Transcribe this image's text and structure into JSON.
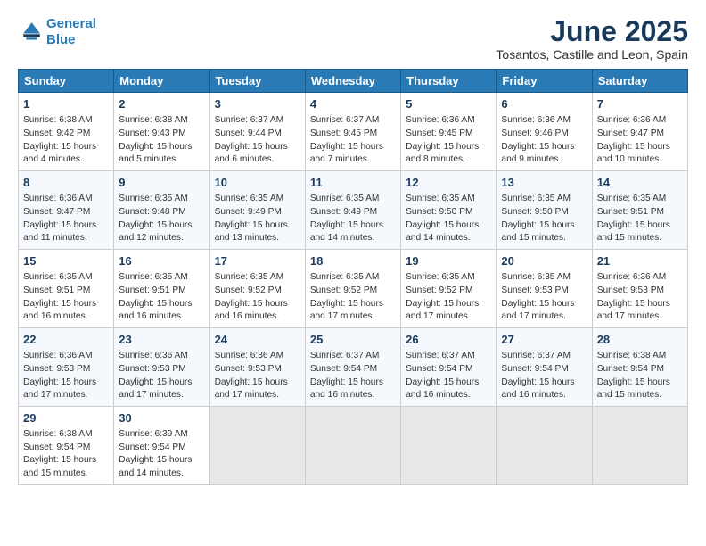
{
  "logo": {
    "line1": "General",
    "line2": "Blue"
  },
  "title": "June 2025",
  "subtitle": "Tosantos, Castille and Leon, Spain",
  "headers": [
    "Sunday",
    "Monday",
    "Tuesday",
    "Wednesday",
    "Thursday",
    "Friday",
    "Saturday"
  ],
  "weeks": [
    [
      {
        "day": "1",
        "lines": [
          "Sunrise: 6:38 AM",
          "Sunset: 9:42 PM",
          "Daylight: 15 hours",
          "and 4 minutes."
        ]
      },
      {
        "day": "2",
        "lines": [
          "Sunrise: 6:38 AM",
          "Sunset: 9:43 PM",
          "Daylight: 15 hours",
          "and 5 minutes."
        ]
      },
      {
        "day": "3",
        "lines": [
          "Sunrise: 6:37 AM",
          "Sunset: 9:44 PM",
          "Daylight: 15 hours",
          "and 6 minutes."
        ]
      },
      {
        "day": "4",
        "lines": [
          "Sunrise: 6:37 AM",
          "Sunset: 9:45 PM",
          "Daylight: 15 hours",
          "and 7 minutes."
        ]
      },
      {
        "day": "5",
        "lines": [
          "Sunrise: 6:36 AM",
          "Sunset: 9:45 PM",
          "Daylight: 15 hours",
          "and 8 minutes."
        ]
      },
      {
        "day": "6",
        "lines": [
          "Sunrise: 6:36 AM",
          "Sunset: 9:46 PM",
          "Daylight: 15 hours",
          "and 9 minutes."
        ]
      },
      {
        "day": "7",
        "lines": [
          "Sunrise: 6:36 AM",
          "Sunset: 9:47 PM",
          "Daylight: 15 hours",
          "and 10 minutes."
        ]
      }
    ],
    [
      {
        "day": "8",
        "lines": [
          "Sunrise: 6:36 AM",
          "Sunset: 9:47 PM",
          "Daylight: 15 hours",
          "and 11 minutes."
        ]
      },
      {
        "day": "9",
        "lines": [
          "Sunrise: 6:35 AM",
          "Sunset: 9:48 PM",
          "Daylight: 15 hours",
          "and 12 minutes."
        ]
      },
      {
        "day": "10",
        "lines": [
          "Sunrise: 6:35 AM",
          "Sunset: 9:49 PM",
          "Daylight: 15 hours",
          "and 13 minutes."
        ]
      },
      {
        "day": "11",
        "lines": [
          "Sunrise: 6:35 AM",
          "Sunset: 9:49 PM",
          "Daylight: 15 hours",
          "and 14 minutes."
        ]
      },
      {
        "day": "12",
        "lines": [
          "Sunrise: 6:35 AM",
          "Sunset: 9:50 PM",
          "Daylight: 15 hours",
          "and 14 minutes."
        ]
      },
      {
        "day": "13",
        "lines": [
          "Sunrise: 6:35 AM",
          "Sunset: 9:50 PM",
          "Daylight: 15 hours",
          "and 15 minutes."
        ]
      },
      {
        "day": "14",
        "lines": [
          "Sunrise: 6:35 AM",
          "Sunset: 9:51 PM",
          "Daylight: 15 hours",
          "and 15 minutes."
        ]
      }
    ],
    [
      {
        "day": "15",
        "lines": [
          "Sunrise: 6:35 AM",
          "Sunset: 9:51 PM",
          "Daylight: 15 hours",
          "and 16 minutes."
        ]
      },
      {
        "day": "16",
        "lines": [
          "Sunrise: 6:35 AM",
          "Sunset: 9:51 PM",
          "Daylight: 15 hours",
          "and 16 minutes."
        ]
      },
      {
        "day": "17",
        "lines": [
          "Sunrise: 6:35 AM",
          "Sunset: 9:52 PM",
          "Daylight: 15 hours",
          "and 16 minutes."
        ]
      },
      {
        "day": "18",
        "lines": [
          "Sunrise: 6:35 AM",
          "Sunset: 9:52 PM",
          "Daylight: 15 hours",
          "and 17 minutes."
        ]
      },
      {
        "day": "19",
        "lines": [
          "Sunrise: 6:35 AM",
          "Sunset: 9:52 PM",
          "Daylight: 15 hours",
          "and 17 minutes."
        ]
      },
      {
        "day": "20",
        "lines": [
          "Sunrise: 6:35 AM",
          "Sunset: 9:53 PM",
          "Daylight: 15 hours",
          "and 17 minutes."
        ]
      },
      {
        "day": "21",
        "lines": [
          "Sunrise: 6:36 AM",
          "Sunset: 9:53 PM",
          "Daylight: 15 hours",
          "and 17 minutes."
        ]
      }
    ],
    [
      {
        "day": "22",
        "lines": [
          "Sunrise: 6:36 AM",
          "Sunset: 9:53 PM",
          "Daylight: 15 hours",
          "and 17 minutes."
        ]
      },
      {
        "day": "23",
        "lines": [
          "Sunrise: 6:36 AM",
          "Sunset: 9:53 PM",
          "Daylight: 15 hours",
          "and 17 minutes."
        ]
      },
      {
        "day": "24",
        "lines": [
          "Sunrise: 6:36 AM",
          "Sunset: 9:53 PM",
          "Daylight: 15 hours",
          "and 17 minutes."
        ]
      },
      {
        "day": "25",
        "lines": [
          "Sunrise: 6:37 AM",
          "Sunset: 9:54 PM",
          "Daylight: 15 hours",
          "and 16 minutes."
        ]
      },
      {
        "day": "26",
        "lines": [
          "Sunrise: 6:37 AM",
          "Sunset: 9:54 PM",
          "Daylight: 15 hours",
          "and 16 minutes."
        ]
      },
      {
        "day": "27",
        "lines": [
          "Sunrise: 6:37 AM",
          "Sunset: 9:54 PM",
          "Daylight: 15 hours",
          "and 16 minutes."
        ]
      },
      {
        "day": "28",
        "lines": [
          "Sunrise: 6:38 AM",
          "Sunset: 9:54 PM",
          "Daylight: 15 hours",
          "and 15 minutes."
        ]
      }
    ],
    [
      {
        "day": "29",
        "lines": [
          "Sunrise: 6:38 AM",
          "Sunset: 9:54 PM",
          "Daylight: 15 hours",
          "and 15 minutes."
        ]
      },
      {
        "day": "30",
        "lines": [
          "Sunrise: 6:39 AM",
          "Sunset: 9:54 PM",
          "Daylight: 15 hours",
          "and 14 minutes."
        ]
      },
      {
        "day": "",
        "lines": []
      },
      {
        "day": "",
        "lines": []
      },
      {
        "day": "",
        "lines": []
      },
      {
        "day": "",
        "lines": []
      },
      {
        "day": "",
        "lines": []
      }
    ]
  ]
}
